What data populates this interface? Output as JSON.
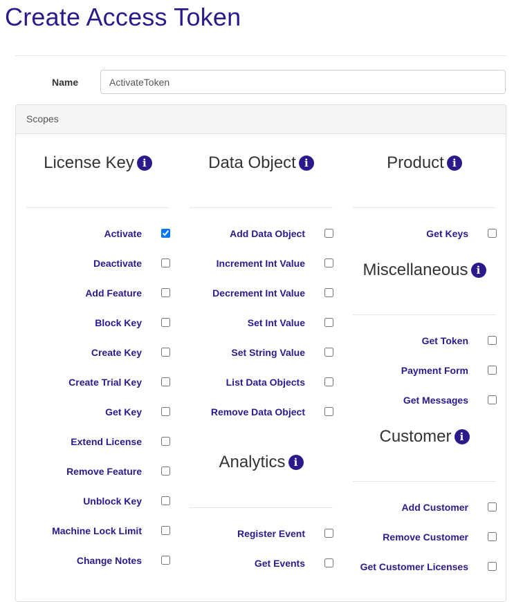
{
  "page": {
    "title": "Create Access Token"
  },
  "form": {
    "name_label": "Name",
    "name_value": "ActivateToken"
  },
  "scopes": {
    "heading": "Scopes",
    "info_icon": "info-circle-icon",
    "accent_color": "#2a1a8c",
    "license_key": {
      "title": "License Key",
      "items": [
        {
          "label": "Activate",
          "checked": true
        },
        {
          "label": "Deactivate",
          "checked": false
        },
        {
          "label": "Add Feature",
          "checked": false
        },
        {
          "label": "Block Key",
          "checked": false
        },
        {
          "label": "Create Key",
          "checked": false
        },
        {
          "label": "Create Trial Key",
          "checked": false
        },
        {
          "label": "Get Key",
          "checked": false
        },
        {
          "label": "Extend License",
          "checked": false
        },
        {
          "label": "Remove Feature",
          "checked": false
        },
        {
          "label": "Unblock Key",
          "checked": false
        },
        {
          "label": "Machine Lock Limit",
          "checked": false
        },
        {
          "label": "Change Notes",
          "checked": false
        }
      ]
    },
    "data_object": {
      "title": "Data Object",
      "items": [
        {
          "label": "Add Data Object",
          "checked": false
        },
        {
          "label": "Increment Int Value",
          "checked": false
        },
        {
          "label": "Decrement Int Value",
          "checked": false
        },
        {
          "label": "Set Int Value",
          "checked": false
        },
        {
          "label": "Set String Value",
          "checked": false
        },
        {
          "label": "List Data Objects",
          "checked": false
        },
        {
          "label": "Remove Data Object",
          "checked": false
        }
      ]
    },
    "analytics": {
      "title": "Analytics",
      "items": [
        {
          "label": "Register Event",
          "checked": false
        },
        {
          "label": "Get Events",
          "checked": false
        }
      ]
    },
    "product": {
      "title": "Product",
      "items": [
        {
          "label": "Get Keys",
          "checked": false
        }
      ]
    },
    "miscellaneous": {
      "title": "Miscellaneous",
      "items": [
        {
          "label": "Get Token",
          "checked": false
        },
        {
          "label": "Payment Form",
          "checked": false
        },
        {
          "label": "Get Messages",
          "checked": false
        }
      ]
    },
    "customer": {
      "title": "Customer",
      "items": [
        {
          "label": "Add Customer",
          "checked": false
        },
        {
          "label": "Remove Customer",
          "checked": false
        },
        {
          "label": "Get Customer Licenses",
          "checked": false
        }
      ]
    }
  }
}
